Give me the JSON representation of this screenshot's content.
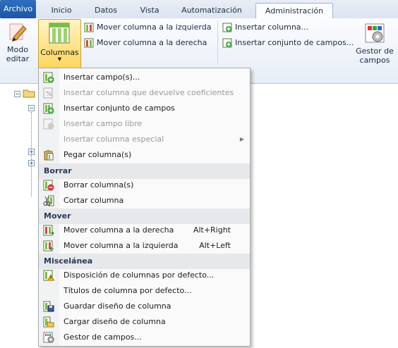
{
  "tabs": {
    "file": "Archivo",
    "items": [
      "Inicio",
      "Datos",
      "Vista",
      "Automatización",
      "Administración"
    ]
  },
  "ribbon": {
    "edit_mode": [
      "Modo",
      "editar"
    ],
    "columns_label": "Columnas",
    "move_left": "Mover columna a la izquierda",
    "move_right": "Mover columna a la derecha",
    "insert_column": "Insertar columna...",
    "insert_field_set": "Insertar conjunto de campos...",
    "field_manager": [
      "Gestor de",
      "campos"
    ]
  },
  "menu": {
    "items_top": [
      {
        "label": "Insertar campo(s)...",
        "icon": "insert-field-icon",
        "enabled": true
      },
      {
        "label": "Insertar columna que devuelve coeficientes",
        "icon": "coefficient-column-icon",
        "enabled": false
      },
      {
        "label": "Insertar conjunto de campos",
        "icon": "insert-field-set-icon",
        "enabled": true
      },
      {
        "label": "Insertar campo libre",
        "icon": "free-field-icon",
        "enabled": false
      },
      {
        "label": "Insertar columna especial",
        "icon": "",
        "enabled": false,
        "submenu": true
      },
      {
        "label": "Pegar columna(s)",
        "icon": "paste-icon",
        "enabled": true
      }
    ],
    "section_borrar": "Borrar",
    "items_borrar": [
      {
        "label": "Borrar columna(s)",
        "icon": "delete-column-icon"
      },
      {
        "label": "Cortar columna",
        "icon": "cut-icon"
      }
    ],
    "section_mover": "Mover",
    "items_mover": [
      {
        "label": "Mover columna a la derecha",
        "shortcut": "Alt+Right",
        "icon": "move-right-icon"
      },
      {
        "label": "Mover columna a la izquierda",
        "shortcut": "Alt+Left",
        "icon": "move-left-icon"
      }
    ],
    "section_misc": "Miscelánea",
    "items_misc": [
      {
        "label": "Disposición de columnas por defecto...",
        "icon": "warning-layout-icon"
      },
      {
        "label": "Títulos de columna por defecto...",
        "icon": ""
      },
      {
        "label": "Guardar diseño de columna",
        "icon": "save-icon"
      },
      {
        "label": "Cargar diseño de columna",
        "icon": "folder-open-icon"
      },
      {
        "label": "Gestor de campos...",
        "icon": "field-manager-icon"
      }
    ]
  },
  "colors": {
    "file_tab": "#1d56a3",
    "highlight": "#ffd65c",
    "disabled_text": "#9a9a9a"
  }
}
